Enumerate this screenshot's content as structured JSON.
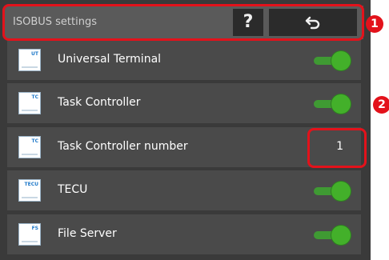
{
  "header": {
    "title": "ISOBUS settings",
    "help_label": "?",
    "back_icon": "return-arrow-icon"
  },
  "rows": [
    {
      "label": "Universal Terminal",
      "icon_text": "UT",
      "toggle": "on"
    },
    {
      "label": "Task Controller",
      "icon_text": "TC",
      "toggle": "on"
    },
    {
      "label": "Task Controller number",
      "icon_text": "TC",
      "value": "1"
    },
    {
      "label": "TECU",
      "icon_text": "TECU",
      "toggle": "on"
    },
    {
      "label": "File Server",
      "icon_text": "FS",
      "toggle": "on"
    }
  ],
  "annotations": {
    "badge1": "1",
    "badge2": "2",
    "color": "#e3121b"
  },
  "colors": {
    "toggle_on": "#43b02a",
    "panel": "#3a3a3a"
  }
}
